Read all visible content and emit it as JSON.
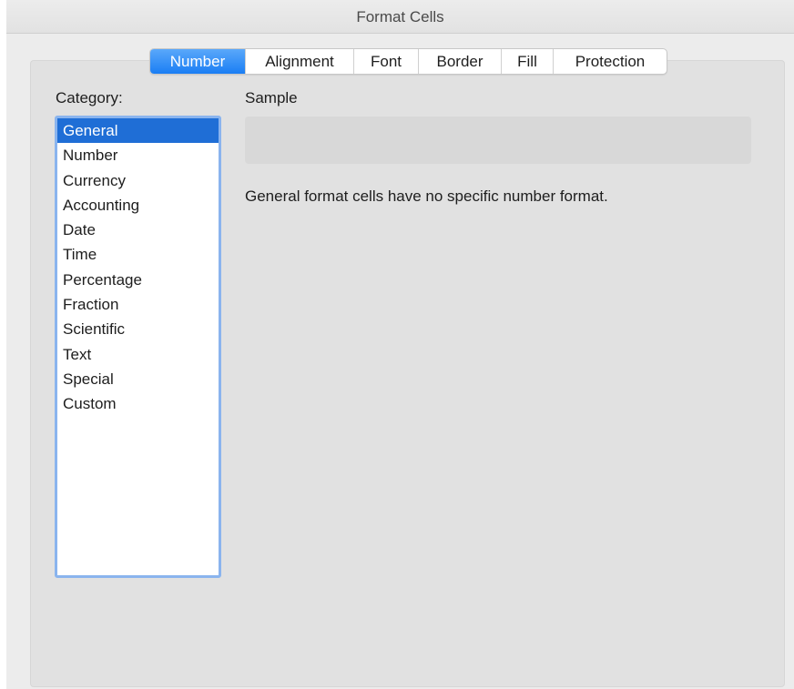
{
  "window": {
    "title": "Format Cells"
  },
  "tabs": [
    {
      "label": "Number",
      "active": true
    },
    {
      "label": "Alignment",
      "active": false
    },
    {
      "label": "Font",
      "active": false
    },
    {
      "label": "Border",
      "active": false
    },
    {
      "label": "Fill",
      "active": false
    },
    {
      "label": "Protection",
      "active": false
    }
  ],
  "category": {
    "label": "Category:",
    "items": [
      "General",
      "Number",
      "Currency",
      "Accounting",
      "Date",
      "Time",
      "Percentage",
      "Fraction",
      "Scientific",
      "Text",
      "Special",
      "Custom"
    ],
    "selected": "General"
  },
  "sample": {
    "label": "Sample",
    "value": ""
  },
  "description": "General format cells have no specific number format.",
  "colors": {
    "accent": "#1a7ef4",
    "selection": "#1f6ed6",
    "focus_ring": "#8ab4ee"
  }
}
